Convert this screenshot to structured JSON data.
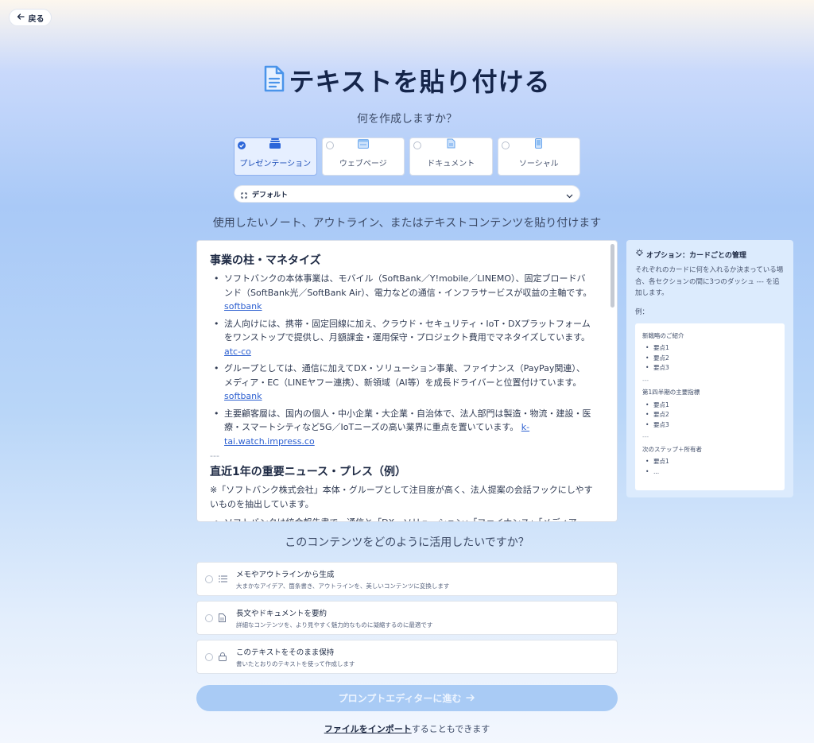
{
  "nav": {
    "back_label": "戻る"
  },
  "header": {
    "title": "テキストを貼り付ける",
    "question": "何を作成しますか？"
  },
  "content_types": [
    {
      "label": "プレゼンテーション",
      "icon": "presentation-icon",
      "selected": true
    },
    {
      "label": "ウェブページ",
      "icon": "webpage-icon",
      "selected": false
    },
    {
      "label": "ドキュメント",
      "icon": "document-icon",
      "selected": false
    },
    {
      "label": "ソーシャル",
      "icon": "mobile-icon",
      "selected": false
    }
  ],
  "theme": {
    "value": "デフォルト"
  },
  "instruction": "使用したいノート、アウトライン、またはテキストコンテンツを貼り付けます",
  "editor": {
    "section1_heading": "事業の柱・マネタイズ",
    "items1": [
      {
        "text": "ソフトバンクの本体事業は、モバイル（SoftBank／Y!mobile／LINEMO）、固定ブロードバンド（SoftBank光／SoftBank Air）、電力などの通信・インフラサービスが収益の主軸です。",
        "link": "softbank"
      },
      {
        "text": "法人向けには、携帯・固定回線に加え、クラウド・セキュリティ・IoT・DXプラットフォームをワンストップで提供し、月額課金・運用保守・プロジェクト費用でマネタイズしています。",
        "link": "atc-co"
      },
      {
        "text": "グループとしては、通信に加えてDX・ソリューション事業、ファイナンス（PayPay関連）、メディア・EC（LINEヤフー連携）、新領域（AI等）を成長ドライバーと位置付けています。",
        "link": "softbank"
      },
      {
        "text": "主要顧客層は、国内の個人・中小企業・大企業・自治体で、法人部門は製造・物流・建設・医療・スマートシティなど5G／IoTニーズの高い業界に重点を置いています。",
        "link": "k-tai.watch.impress.co"
      }
    ],
    "separator": "---",
    "section2_heading": "直近1年の重要ニュース・プレス（例）",
    "section2_note": "※「ソフトバンク株式会社」本体・グループとして注目度が高く、法人提案の会話フックにしやすいものを抽出しています。",
    "items2": [
      {
        "text": "ソフトバンクは統合報告書で、通信と「DX・ソリューション」「ファイナンス」「メディア・EC」「新領域」を連携させた『Beyond Carrier』戦略を継続し、営業利益の成長を掲げています。"
      }
    ]
  },
  "side_panel": {
    "title": "オプション：カードごとの管理",
    "description": "それぞれのカードに何を入れるか決まっている場合、各セクションの間に3つのダッシュ --- を追加します。",
    "example_label": "例：",
    "example": {
      "title1": "新戦略のご紹介",
      "items1": [
        "要点1",
        "要点2",
        "要点3"
      ],
      "sep": "---",
      "title2": "第1四半期の主要指標",
      "items2": [
        "要点1",
        "要点2",
        "要点3"
      ],
      "title3": "次のステップ＋所有者",
      "items3": [
        "要点1",
        "..."
      ]
    }
  },
  "usage": {
    "question": "このコンテンツをどのように活用したいですか？",
    "options": [
      {
        "title": "メモやアウトラインから生成",
        "desc": "大まかなアイデア、箇条書き、アウトラインを、美しいコンテンツに変換します",
        "icon": "list-icon"
      },
      {
        "title": "長文やドキュメントを要約",
        "desc": "詳細なコンテンツを、より見やすく魅力的なものに凝縮するのに最適です",
        "icon": "document-icon"
      },
      {
        "title": "このテキストをそのまま保持",
        "desc": "書いたとおりのテキストを使って作成します",
        "icon": "lock-icon"
      }
    ]
  },
  "footer": {
    "continue_label": "プロンプトエディターに進む",
    "import_link": "ファイルをインポート",
    "import_suffix": "することもできます"
  },
  "colors": {
    "accent": "#2c66d9",
    "button_disabled": "#a9cbf5",
    "title": "#15254a"
  }
}
